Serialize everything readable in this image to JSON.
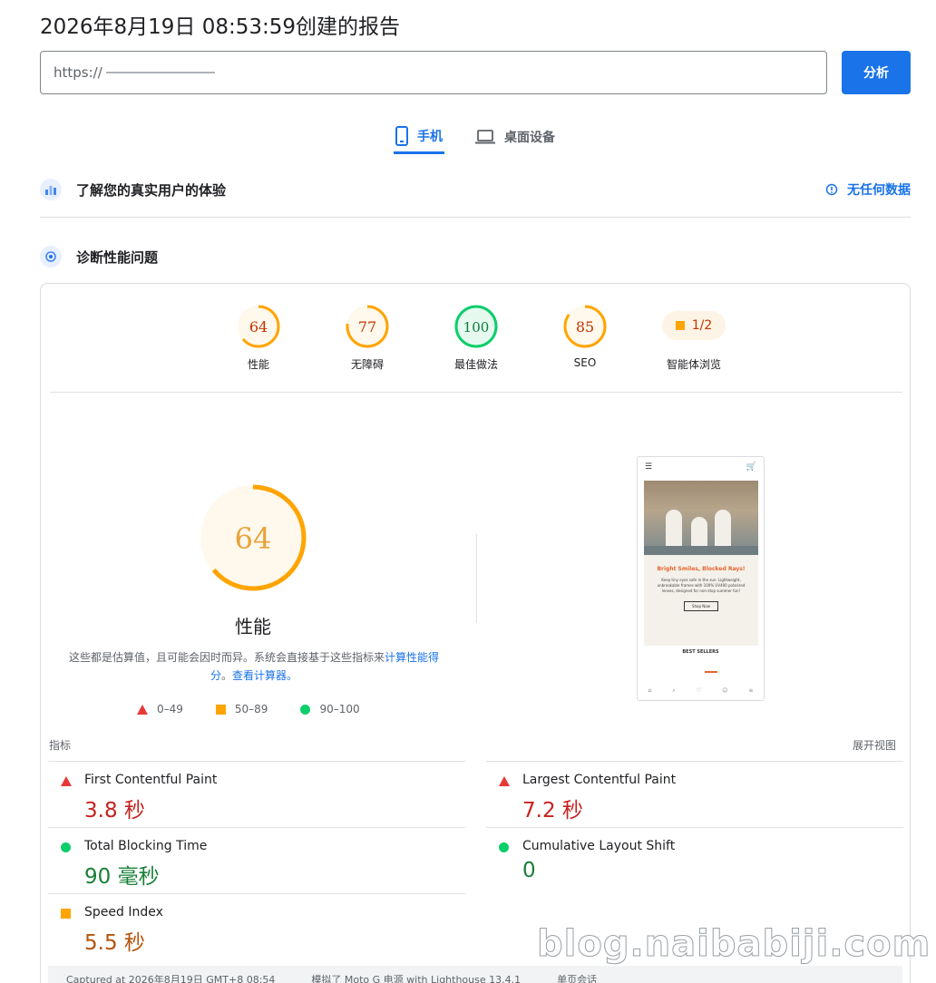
{
  "header": {
    "title": "2026年8月19日 08:53:59创建的报告"
  },
  "url_bar": {
    "value": "https://",
    "analyze_label": "分析"
  },
  "tabs": [
    {
      "label": "手机",
      "icon": "phone-icon",
      "active": true
    },
    {
      "label": "桌面设备",
      "icon": "laptop-icon",
      "active": false
    }
  ],
  "crux": {
    "title": "了解您的真实用户的体验",
    "no_data": "无任何数据"
  },
  "diagnose": {
    "title": "诊断性能问题"
  },
  "categories": [
    {
      "label": "性能",
      "score": "64",
      "color": "#ffa400",
      "fraction": 0.64
    },
    {
      "label": "无障碍",
      "score": "77",
      "color": "#ffa400",
      "fraction": 0.77
    },
    {
      "label": "最佳做法",
      "score": "100",
      "color": "#0cce6b",
      "fraction": 1.0
    },
    {
      "label": "SEO",
      "score": "85",
      "color": "#ffa400",
      "fraction": 0.85
    },
    {
      "label": "智能体浏览",
      "score": "1/2",
      "color": "#ffa400"
    }
  ],
  "performance": {
    "score": "64",
    "fraction": 0.64,
    "title": "性能",
    "desc_text": "这些都是估算值，且可能会因时而异。系统会直接基于这些指标来",
    "desc_link1": "计算性能得分",
    "desc_sep": "。",
    "desc_link2": "查看计算器。",
    "legend": {
      "poor": "0–49",
      "average": "50–89",
      "good": "90–100"
    }
  },
  "screenshot": {
    "promo_title": "Bright Smiles, Blocked Rays!",
    "promo_text": "Keep tiny eyes safe in the sun. Lightweight, unbreakable frames with 100% UV400 polarized lenses, designed for non-stop summer fun!",
    "promo_button": "Shop Now",
    "best_title": "BEST SELLERS",
    "nav": [
      "Home",
      "Search",
      "Wishlist",
      "Account",
      "Category"
    ]
  },
  "metrics": {
    "heading": "指标",
    "expand": "展开视图",
    "items": [
      {
        "name": "First Contentful Paint",
        "value": "3.8 秒",
        "status": "poor"
      },
      {
        "name": "Largest Contentful Paint",
        "value": "7.2 秒",
        "status": "poor"
      },
      {
        "name": "Total Blocking Time",
        "value": "90 毫秒",
        "status": "good"
      },
      {
        "name": "Cumulative Layout Shift",
        "value": "0",
        "status": "good"
      },
      {
        "name": "Speed Index",
        "value": "5.5 秒",
        "status": "average"
      }
    ]
  },
  "footer": {
    "items": [
      "Captured at 2026年8月19日 GMT+8 08:54",
      "模拟了 Moto G 电源 with Lighthouse 13.4.1",
      "单页会话"
    ]
  },
  "watermark": "blog.naibabiji.com"
}
